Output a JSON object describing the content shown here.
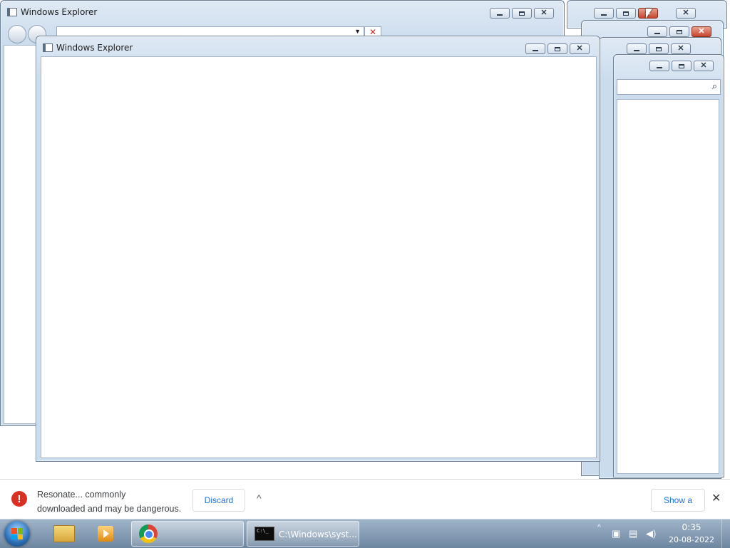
{
  "windows": {
    "back_title": "Windows Explorer",
    "front_title": "Windows Explorer"
  },
  "download_bar": {
    "message_line1": "Resonate... commonly",
    "message_line2": "downloaded and may be dangerous.",
    "discard_label": "Discard",
    "show_all_label": "Show a"
  },
  "taskbar": {
    "cmd_label": "C:\\Windows\\syst...",
    "clock_time": "0:35",
    "clock_date": "20-08-2022"
  },
  "icons": {
    "start": "start-orb-icon",
    "explorer": "folder-icon",
    "media": "media-player-icon",
    "chrome": "chrome-icon",
    "cmd": "cmd-icon"
  }
}
